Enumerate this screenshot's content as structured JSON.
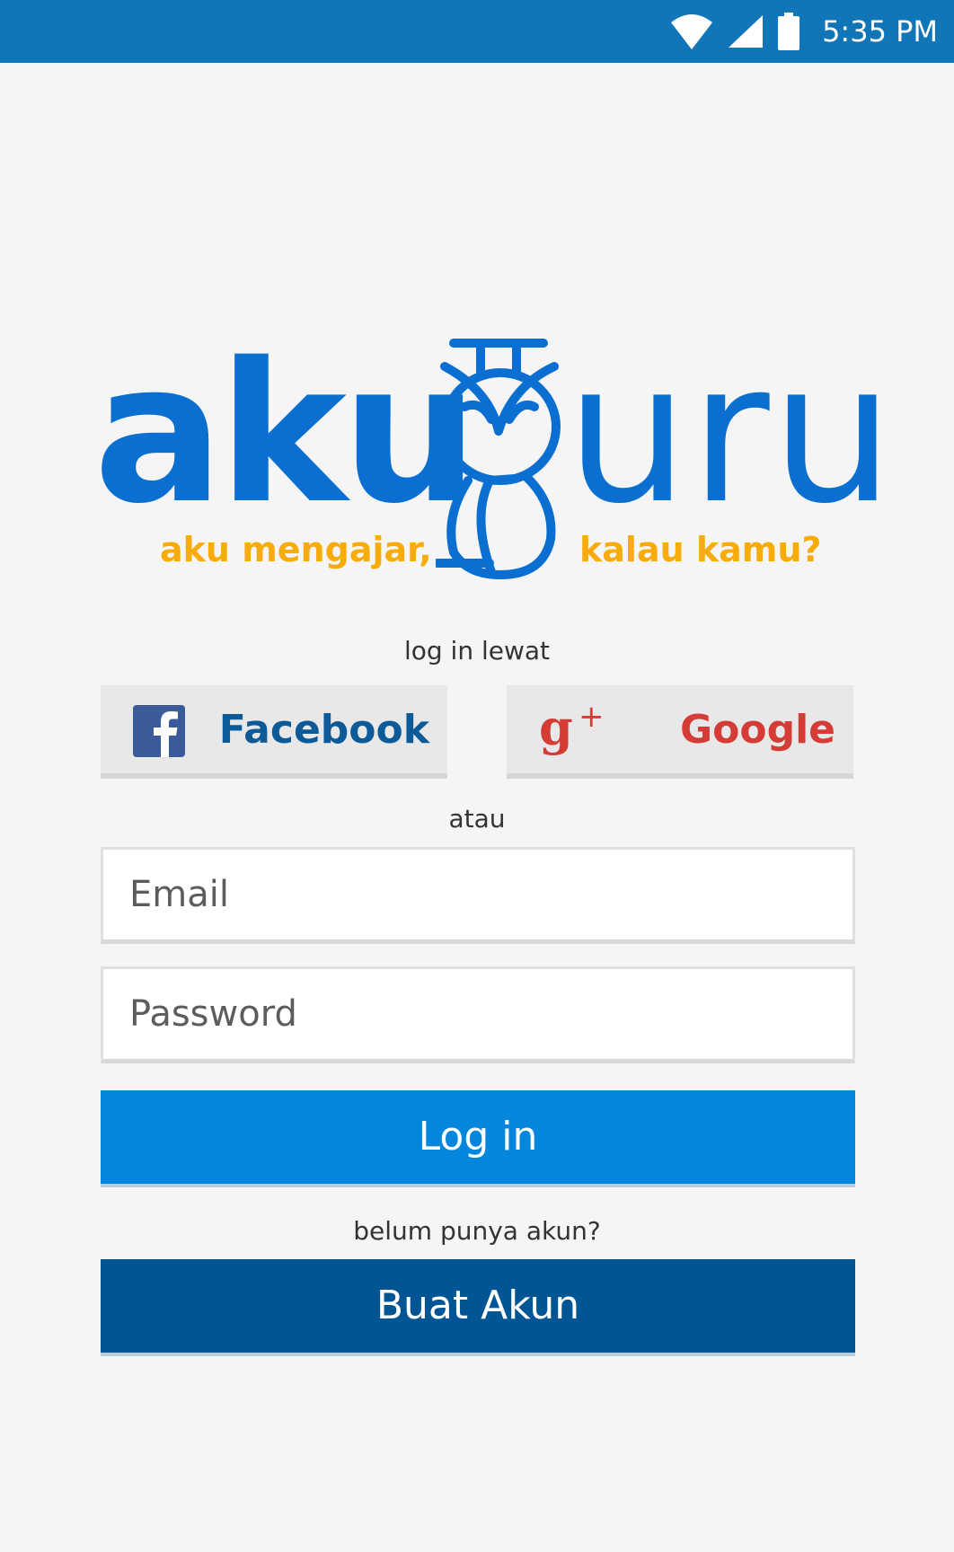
{
  "status_bar": {
    "time": "5:35 PM",
    "icons": [
      "wifi-icon",
      "cellular-signal-icon",
      "battery-icon"
    ],
    "color": "#1176b8"
  },
  "logo": {
    "left_text": "aku",
    "right_text": "uru",
    "tagline_left": "aku mengajar,",
    "tagline_right": "kalau kamu?",
    "primary_color": "#0a6fd0",
    "tagline_color": "#f8ac0c"
  },
  "login_via_label": "log in lewat",
  "social": {
    "facebook": {
      "label": "Facebook",
      "icon": "facebook-icon",
      "color": "#0d5a99"
    },
    "google": {
      "label": "Google",
      "icon": "google-plus-icon",
      "color": "#d43c35"
    }
  },
  "or_label": "atau",
  "form": {
    "email_placeholder": "Email",
    "email_value": "",
    "password_placeholder": "Password",
    "password_value": ""
  },
  "login_button": {
    "label": "Log in",
    "color": "#0386dc"
  },
  "no_account_label": "belum punya akun?",
  "signup_button": {
    "label": "Buat Akun",
    "color": "#005595"
  }
}
